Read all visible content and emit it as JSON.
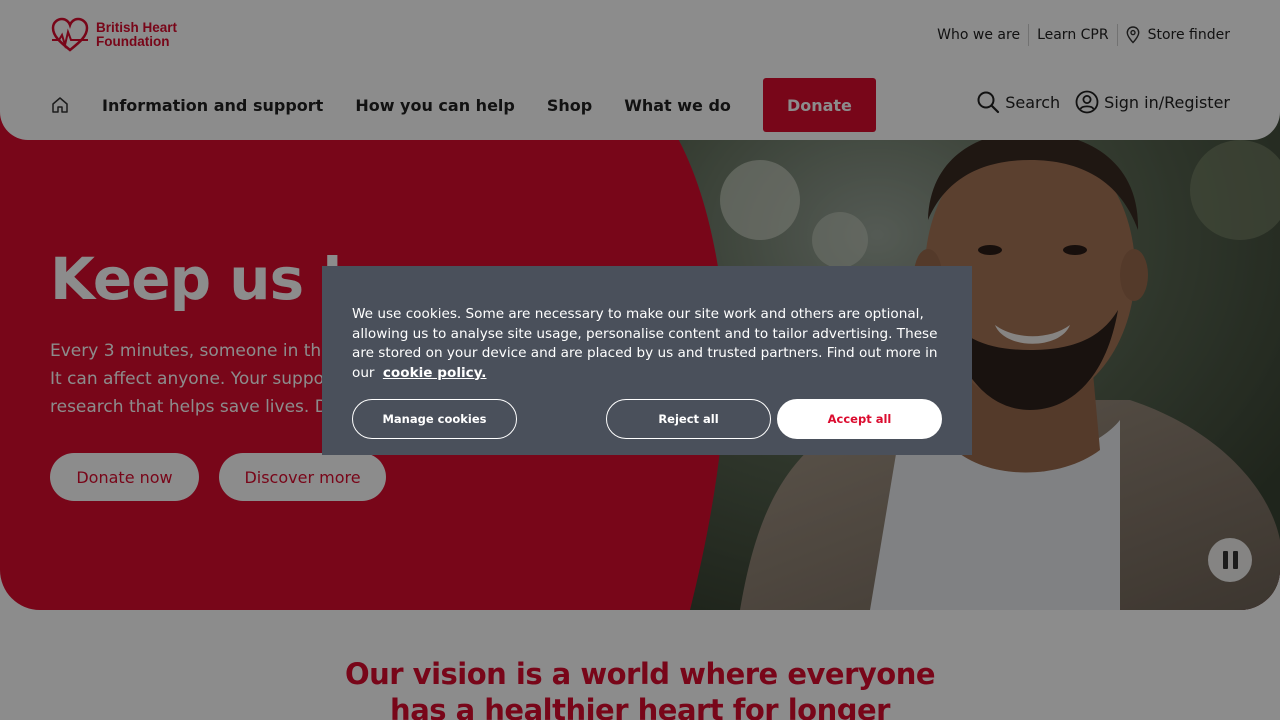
{
  "brand": {
    "logo_line1": "British Heart",
    "logo_line2": "Foundation",
    "primary_color": "#db0c2f"
  },
  "utility_nav": {
    "items": [
      {
        "label": "Who we are"
      },
      {
        "label": "Learn CPR"
      },
      {
        "label": "Store finder",
        "icon": "location-pin-icon"
      }
    ]
  },
  "main_nav": {
    "home_icon": "home-icon",
    "items": [
      {
        "label": "Information and support"
      },
      {
        "label": "How you can help"
      },
      {
        "label": "Shop"
      },
      {
        "label": "What we do"
      }
    ],
    "donate_label": "Donate",
    "search_label": "Search",
    "signin_label": "Sign in/Register"
  },
  "hero": {
    "title": "Keep us bea",
    "text_lines": [
      "Every 3 minutes, someone in the",
      "It can affect anyone. Your support",
      "research that helps save lives. Do"
    ],
    "buttons": {
      "donate_now": "Donate now",
      "discover_more": "Discover more"
    },
    "pause_icon": "pause-icon"
  },
  "vision": {
    "line1": "Our vision is a world where everyone",
    "line2": "has a healthier heart for longer"
  },
  "cookie_banner": {
    "text": "We use cookies. Some are necessary to make our site work and others are optional, allowing us to analyse site usage, personalise content and to tailor advertising. These are stored on your device and are placed by us and trusted partners. Find out more in our",
    "policy_link": "cookie policy.",
    "manage_label": "Manage cookies",
    "reject_label": "Reject all",
    "accept_label": "Accept all"
  }
}
